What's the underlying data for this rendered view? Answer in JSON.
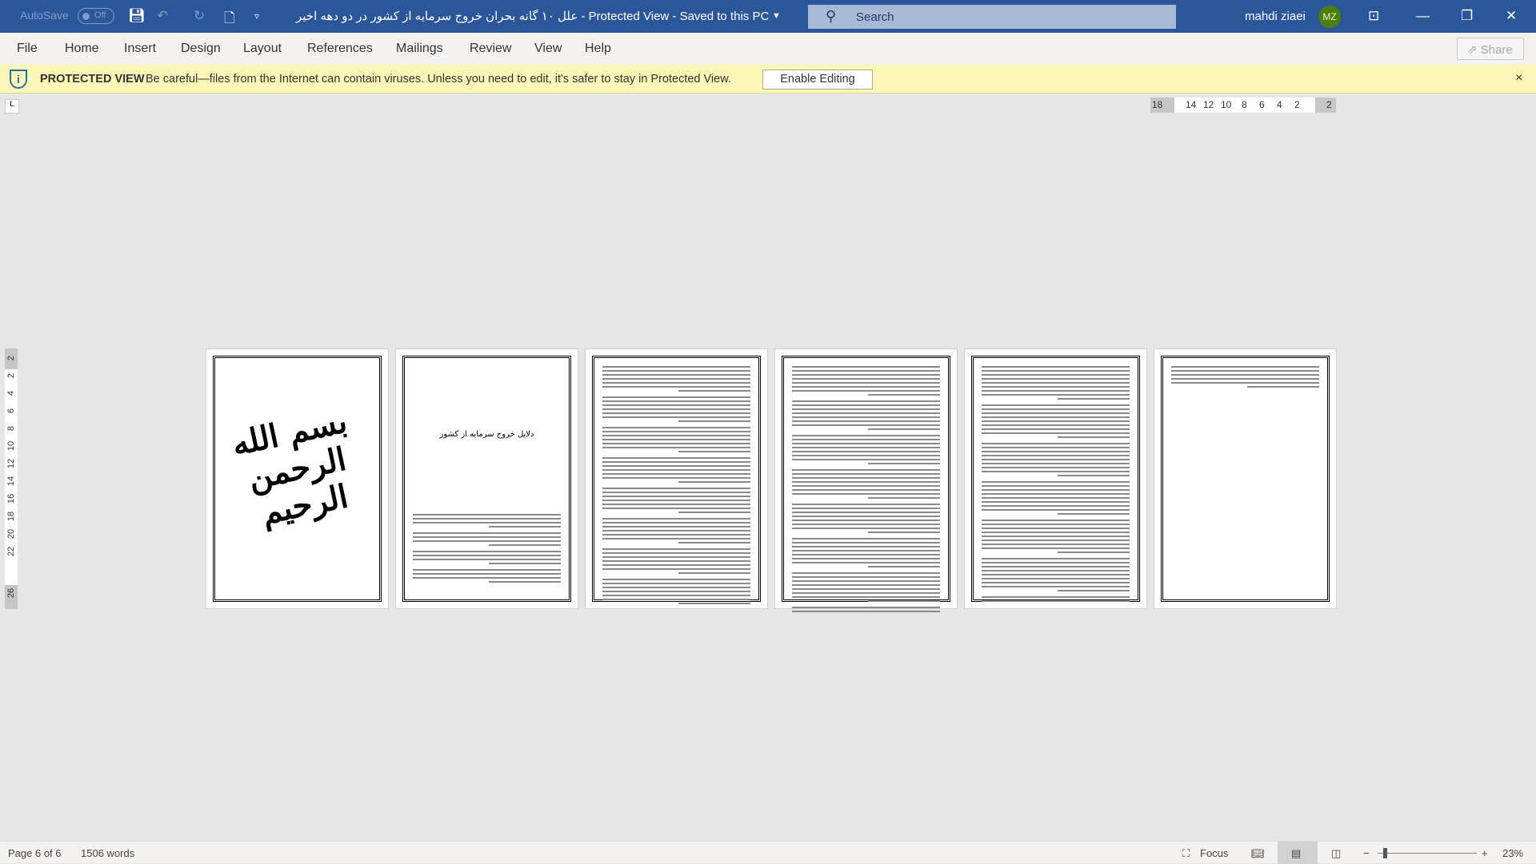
{
  "titlebar": {
    "autosave": "AutoSave",
    "autosave_state": "Off",
    "title": "علل ۱۰ گانه بحران خروج سرمایه از کشور در دو دهه اخیر  -  Protected View  -  Saved to this PC",
    "search_placeholder": "Search",
    "user_name": "mahdi ziaei",
    "user_initials": "MZ",
    "icons": [
      "save-icon",
      "undo-icon",
      "redo-icon",
      "new-document-icon",
      "customize-icon",
      "ribbon-display-icon",
      "minimize-icon",
      "restore-icon",
      "close-icon"
    ]
  },
  "menu": {
    "items": [
      "File",
      "Home",
      "Insert",
      "Design",
      "Layout",
      "References",
      "Mailings",
      "Review",
      "View",
      "Help"
    ],
    "share": "Share"
  },
  "protected": {
    "label": "PROTECTED VIEW",
    "message": "Be careful—files from the Internet can contain viruses. Unless you need to edit, it's safer to stay in Protected View.",
    "enable_button": "Enable Editing",
    "close": "×"
  },
  "ruler": {
    "horizontal": [
      "18",
      "14",
      "12",
      "10",
      "8",
      "6",
      "4",
      "2",
      "2"
    ],
    "vertical": [
      "2",
      "2",
      "4",
      "6",
      "8",
      "10",
      "12",
      "14",
      "16",
      "18",
      "20",
      "22",
      "26"
    ]
  },
  "pages": {
    "p1_calligraphy": "بسم الله الرحمن الرحیم",
    "p2_heading": "دلایل خروج سرمایه از کشور"
  },
  "status": {
    "page": "Page 6 of 6",
    "words": "1506 words",
    "focus": "Focus",
    "zoom": "23%"
  },
  "colors": {
    "titlebar": "#2b579a",
    "protected_bar": "#fcf7b6",
    "avatar": "#4e7d0f"
  }
}
